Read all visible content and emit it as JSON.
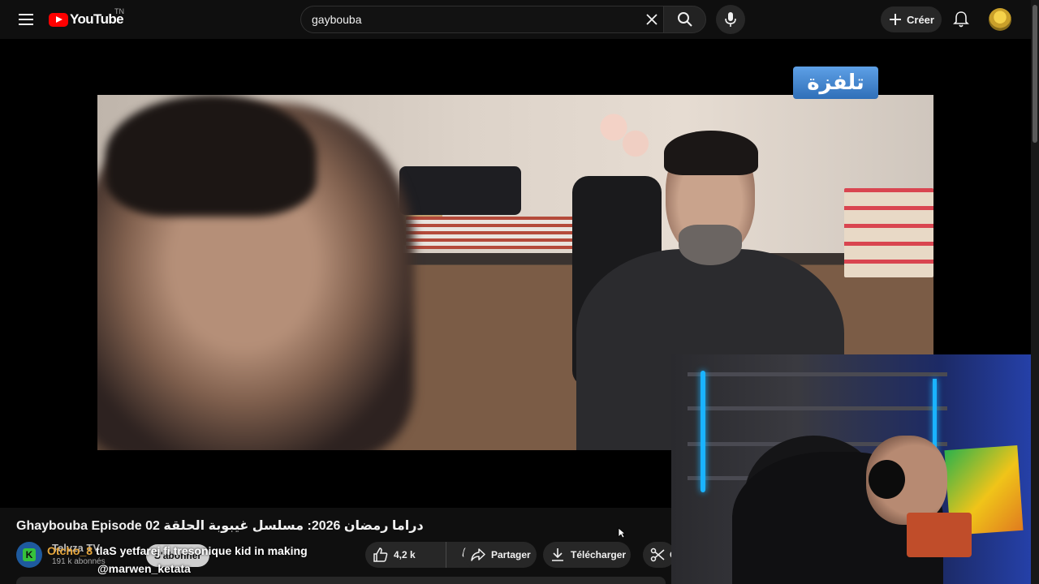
{
  "header": {
    "logo_text": "YouTube",
    "country_code": "TN",
    "search_value": "gaybouba",
    "create_label": "Créer"
  },
  "player": {
    "watermark_text": "تلفزة"
  },
  "video": {
    "title": "Ghaybouba Episode 02 دراما رمضان 2026: مسلسل غيبوبة الحلقة",
    "channel_name": "Telvza TV",
    "subscribers": "191 k abonnés",
    "subscribe_label": "S'abonner",
    "likes": "4,2 k",
    "share_label": "Partager",
    "download_label": "Télécharger",
    "clip_label": "C"
  },
  "stream_overlay": {
    "username": "Otcho_8",
    "message": "tlaS yetfarej fi tresonique kid in making",
    "handle": "@marwen_ketata"
  },
  "colors": {
    "brand_red": "#ff0000",
    "background": "#0f0f0f",
    "pill_bg": "#272727",
    "overlay_user": "#e6a63c"
  }
}
